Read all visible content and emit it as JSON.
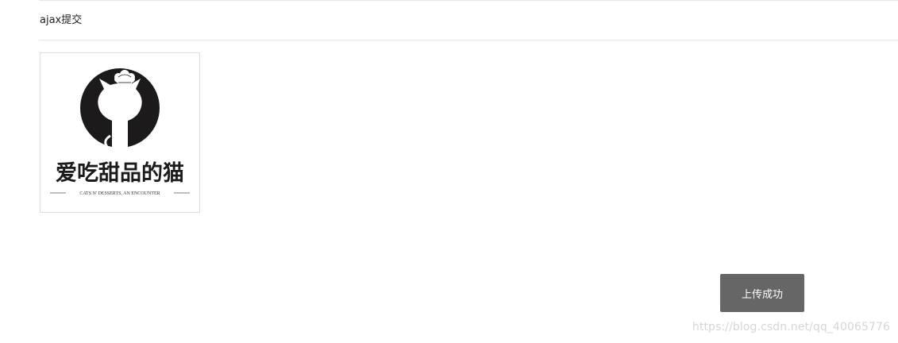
{
  "section": {
    "title": "ajax提交"
  },
  "preview": {
    "logo_text": "爱吃甜品的猫",
    "logo_tagline": "CATS N' DESSERTS, AN ENCOUNTER"
  },
  "toast": {
    "message": "上传成功"
  },
  "watermark": {
    "text": "https://blog.csdn.net/qq_40065776"
  },
  "colors": {
    "toast_bg": "#666666",
    "logo_dark": "#1c1a1a"
  }
}
